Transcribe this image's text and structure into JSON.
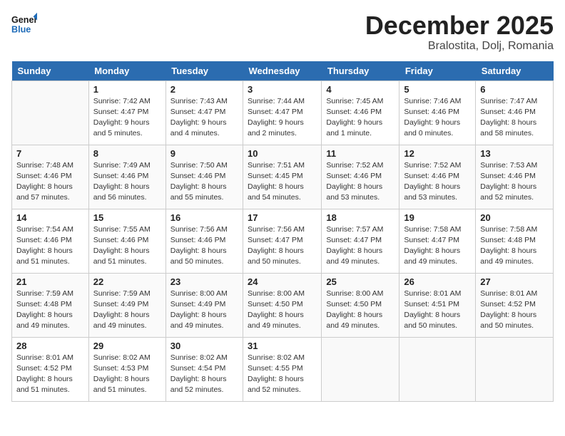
{
  "header": {
    "logo_general": "General",
    "logo_blue": "Blue",
    "month": "December 2025",
    "location": "Bralostita, Dolj, Romania"
  },
  "days_of_week": [
    "Sunday",
    "Monday",
    "Tuesday",
    "Wednesday",
    "Thursday",
    "Friday",
    "Saturday"
  ],
  "weeks": [
    [
      {
        "day": "",
        "info": ""
      },
      {
        "day": "1",
        "info": "Sunrise: 7:42 AM\nSunset: 4:47 PM\nDaylight: 9 hours\nand 5 minutes."
      },
      {
        "day": "2",
        "info": "Sunrise: 7:43 AM\nSunset: 4:47 PM\nDaylight: 9 hours\nand 4 minutes."
      },
      {
        "day": "3",
        "info": "Sunrise: 7:44 AM\nSunset: 4:47 PM\nDaylight: 9 hours\nand 2 minutes."
      },
      {
        "day": "4",
        "info": "Sunrise: 7:45 AM\nSunset: 4:46 PM\nDaylight: 9 hours\nand 1 minute."
      },
      {
        "day": "5",
        "info": "Sunrise: 7:46 AM\nSunset: 4:46 PM\nDaylight: 9 hours\nand 0 minutes."
      },
      {
        "day": "6",
        "info": "Sunrise: 7:47 AM\nSunset: 4:46 PM\nDaylight: 8 hours\nand 58 minutes."
      }
    ],
    [
      {
        "day": "7",
        "info": "Sunrise: 7:48 AM\nSunset: 4:46 PM\nDaylight: 8 hours\nand 57 minutes."
      },
      {
        "day": "8",
        "info": "Sunrise: 7:49 AM\nSunset: 4:46 PM\nDaylight: 8 hours\nand 56 minutes."
      },
      {
        "day": "9",
        "info": "Sunrise: 7:50 AM\nSunset: 4:46 PM\nDaylight: 8 hours\nand 55 minutes."
      },
      {
        "day": "10",
        "info": "Sunrise: 7:51 AM\nSunset: 4:45 PM\nDaylight: 8 hours\nand 54 minutes."
      },
      {
        "day": "11",
        "info": "Sunrise: 7:52 AM\nSunset: 4:46 PM\nDaylight: 8 hours\nand 53 minutes."
      },
      {
        "day": "12",
        "info": "Sunrise: 7:52 AM\nSunset: 4:46 PM\nDaylight: 8 hours\nand 53 minutes."
      },
      {
        "day": "13",
        "info": "Sunrise: 7:53 AM\nSunset: 4:46 PM\nDaylight: 8 hours\nand 52 minutes."
      }
    ],
    [
      {
        "day": "14",
        "info": "Sunrise: 7:54 AM\nSunset: 4:46 PM\nDaylight: 8 hours\nand 51 minutes."
      },
      {
        "day": "15",
        "info": "Sunrise: 7:55 AM\nSunset: 4:46 PM\nDaylight: 8 hours\nand 51 minutes."
      },
      {
        "day": "16",
        "info": "Sunrise: 7:56 AM\nSunset: 4:46 PM\nDaylight: 8 hours\nand 50 minutes."
      },
      {
        "day": "17",
        "info": "Sunrise: 7:56 AM\nSunset: 4:47 PM\nDaylight: 8 hours\nand 50 minutes."
      },
      {
        "day": "18",
        "info": "Sunrise: 7:57 AM\nSunset: 4:47 PM\nDaylight: 8 hours\nand 49 minutes."
      },
      {
        "day": "19",
        "info": "Sunrise: 7:58 AM\nSunset: 4:47 PM\nDaylight: 8 hours\nand 49 minutes."
      },
      {
        "day": "20",
        "info": "Sunrise: 7:58 AM\nSunset: 4:48 PM\nDaylight: 8 hours\nand 49 minutes."
      }
    ],
    [
      {
        "day": "21",
        "info": "Sunrise: 7:59 AM\nSunset: 4:48 PM\nDaylight: 8 hours\nand 49 minutes."
      },
      {
        "day": "22",
        "info": "Sunrise: 7:59 AM\nSunset: 4:49 PM\nDaylight: 8 hours\nand 49 minutes."
      },
      {
        "day": "23",
        "info": "Sunrise: 8:00 AM\nSunset: 4:49 PM\nDaylight: 8 hours\nand 49 minutes."
      },
      {
        "day": "24",
        "info": "Sunrise: 8:00 AM\nSunset: 4:50 PM\nDaylight: 8 hours\nand 49 minutes."
      },
      {
        "day": "25",
        "info": "Sunrise: 8:00 AM\nSunset: 4:50 PM\nDaylight: 8 hours\nand 49 minutes."
      },
      {
        "day": "26",
        "info": "Sunrise: 8:01 AM\nSunset: 4:51 PM\nDaylight: 8 hours\nand 50 minutes."
      },
      {
        "day": "27",
        "info": "Sunrise: 8:01 AM\nSunset: 4:52 PM\nDaylight: 8 hours\nand 50 minutes."
      }
    ],
    [
      {
        "day": "28",
        "info": "Sunrise: 8:01 AM\nSunset: 4:52 PM\nDaylight: 8 hours\nand 51 minutes."
      },
      {
        "day": "29",
        "info": "Sunrise: 8:02 AM\nSunset: 4:53 PM\nDaylight: 8 hours\nand 51 minutes."
      },
      {
        "day": "30",
        "info": "Sunrise: 8:02 AM\nSunset: 4:54 PM\nDaylight: 8 hours\nand 52 minutes."
      },
      {
        "day": "31",
        "info": "Sunrise: 8:02 AM\nSunset: 4:55 PM\nDaylight: 8 hours\nand 52 minutes."
      },
      {
        "day": "",
        "info": ""
      },
      {
        "day": "",
        "info": ""
      },
      {
        "day": "",
        "info": ""
      }
    ]
  ]
}
